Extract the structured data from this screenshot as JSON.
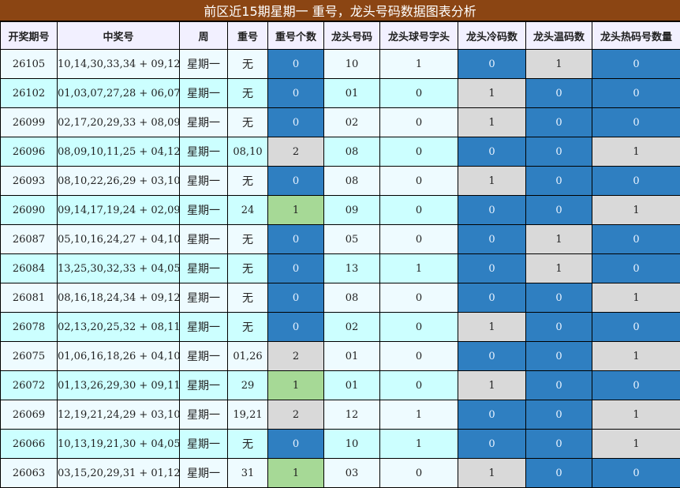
{
  "title": "前区近15期星期一 重号，龙头号码数据图表分析",
  "headers": [
    "开奖期号",
    "中奖号",
    "周",
    "重号",
    "重号个数",
    "龙头号码",
    "龙头球号字头",
    "龙头冷码数",
    "龙头温码数",
    "龙头热码号数量"
  ],
  "colors": {
    "title_bg": "#8b4513",
    "blue": "#2f7fc1",
    "gray": "#d9d9d9",
    "green": "#a6d996",
    "row_light": "#eefbff",
    "row_cyan": "#ccffff"
  },
  "rows": [
    {
      "issue": "26105",
      "numbers": "10,14,30,33,34 + 09,12",
      "weekday": "星期一",
      "repeat": "无",
      "repeat_count": "0",
      "head": "10",
      "head_prefix": "1",
      "cold": "0",
      "warm": "1",
      "hot": "0"
    },
    {
      "issue": "26102",
      "numbers": "01,03,07,27,28 + 06,07",
      "weekday": "星期一",
      "repeat": "无",
      "repeat_count": "0",
      "head": "01",
      "head_prefix": "0",
      "cold": "1",
      "warm": "0",
      "hot": "0"
    },
    {
      "issue": "26099",
      "numbers": "02,17,20,29,33 + 08,09",
      "weekday": "星期一",
      "repeat": "无",
      "repeat_count": "0",
      "head": "02",
      "head_prefix": "0",
      "cold": "1",
      "warm": "0",
      "hot": "0"
    },
    {
      "issue": "26096",
      "numbers": "08,09,10,11,25 + 04,12",
      "weekday": "星期一",
      "repeat": "08,10",
      "repeat_count": "2",
      "head": "08",
      "head_prefix": "0",
      "cold": "0",
      "warm": "0",
      "hot": "1"
    },
    {
      "issue": "26093",
      "numbers": "08,10,22,26,29 + 03,10",
      "weekday": "星期一",
      "repeat": "无",
      "repeat_count": "0",
      "head": "08",
      "head_prefix": "0",
      "cold": "1",
      "warm": "0",
      "hot": "0"
    },
    {
      "issue": "26090",
      "numbers": "09,14,17,19,24 + 02,09",
      "weekday": "星期一",
      "repeat": "24",
      "repeat_count": "1",
      "head": "09",
      "head_prefix": "0",
      "cold": "0",
      "warm": "0",
      "hot": "1"
    },
    {
      "issue": "26087",
      "numbers": "05,10,16,24,27 + 04,10",
      "weekday": "星期一",
      "repeat": "无",
      "repeat_count": "0",
      "head": "05",
      "head_prefix": "0",
      "cold": "0",
      "warm": "1",
      "hot": "0"
    },
    {
      "issue": "26084",
      "numbers": "13,25,30,32,33 + 04,05",
      "weekday": "星期一",
      "repeat": "无",
      "repeat_count": "0",
      "head": "13",
      "head_prefix": "1",
      "cold": "0",
      "warm": "1",
      "hot": "0"
    },
    {
      "issue": "26081",
      "numbers": "08,16,18,24,34 + 09,12",
      "weekday": "星期一",
      "repeat": "无",
      "repeat_count": "0",
      "head": "08",
      "head_prefix": "0",
      "cold": "0",
      "warm": "0",
      "hot": "1"
    },
    {
      "issue": "26078",
      "numbers": "02,13,20,25,32 + 08,11",
      "weekday": "星期一",
      "repeat": "无",
      "repeat_count": "0",
      "head": "02",
      "head_prefix": "0",
      "cold": "1",
      "warm": "0",
      "hot": "0"
    },
    {
      "issue": "26075",
      "numbers": "01,06,16,18,26 + 04,10",
      "weekday": "星期一",
      "repeat": "01,26",
      "repeat_count": "2",
      "head": "01",
      "head_prefix": "0",
      "cold": "0",
      "warm": "0",
      "hot": "1"
    },
    {
      "issue": "26072",
      "numbers": "01,13,26,29,30 + 09,11",
      "weekday": "星期一",
      "repeat": "29",
      "repeat_count": "1",
      "head": "01",
      "head_prefix": "0",
      "cold": "1",
      "warm": "0",
      "hot": "0"
    },
    {
      "issue": "26069",
      "numbers": "12,19,21,24,29 + 03,10",
      "weekday": "星期一",
      "repeat": "19,21",
      "repeat_count": "2",
      "head": "12",
      "head_prefix": "1",
      "cold": "0",
      "warm": "0",
      "hot": "1"
    },
    {
      "issue": "26066",
      "numbers": "10,13,19,21,30 + 04,05",
      "weekday": "星期一",
      "repeat": "无",
      "repeat_count": "0",
      "head": "10",
      "head_prefix": "1",
      "cold": "0",
      "warm": "0",
      "hot": "1"
    },
    {
      "issue": "26063",
      "numbers": "03,15,20,29,31 + 01,12",
      "weekday": "星期一",
      "repeat": "31",
      "repeat_count": "1",
      "head": "03",
      "head_prefix": "0",
      "cold": "1",
      "warm": "0",
      "hot": "0"
    }
  ]
}
